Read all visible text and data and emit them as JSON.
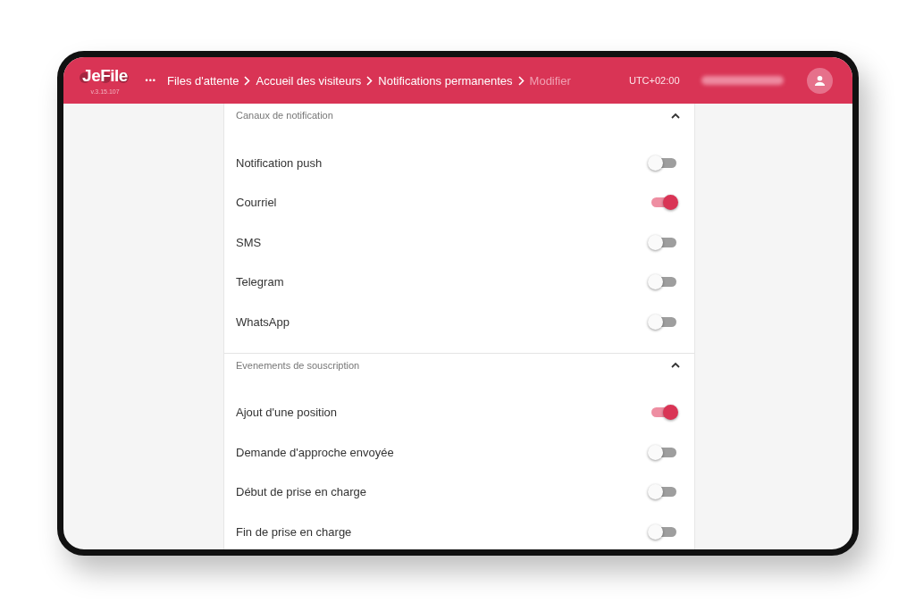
{
  "app": {
    "logo": "JeFile",
    "version": "v.3.15.107",
    "menu": "•••"
  },
  "breadcrumb": [
    {
      "label": "Files d'attente",
      "current": false
    },
    {
      "label": "Accueil des visiteurs",
      "current": false
    },
    {
      "label": "Notifications permanentes",
      "current": false
    },
    {
      "label": "Modifier",
      "current": true
    }
  ],
  "timezone": "UTC+02:00",
  "sections": [
    {
      "title": "Canaux de notification",
      "expanded": true,
      "items": [
        {
          "label": "Notification push",
          "on": false
        },
        {
          "label": "Courriel",
          "on": true
        },
        {
          "label": "SMS",
          "on": false
        },
        {
          "label": "Telegram",
          "on": false
        },
        {
          "label": "WhatsApp",
          "on": false
        }
      ]
    },
    {
      "title": "Evenements de souscription",
      "expanded": true,
      "items": [
        {
          "label": "Ajout d'une position",
          "on": true
        },
        {
          "label": "Demande d'approche envoyée",
          "on": false
        },
        {
          "label": "Début de prise en charge",
          "on": false
        },
        {
          "label": "Fin de prise en charge",
          "on": false
        }
      ]
    }
  ]
}
